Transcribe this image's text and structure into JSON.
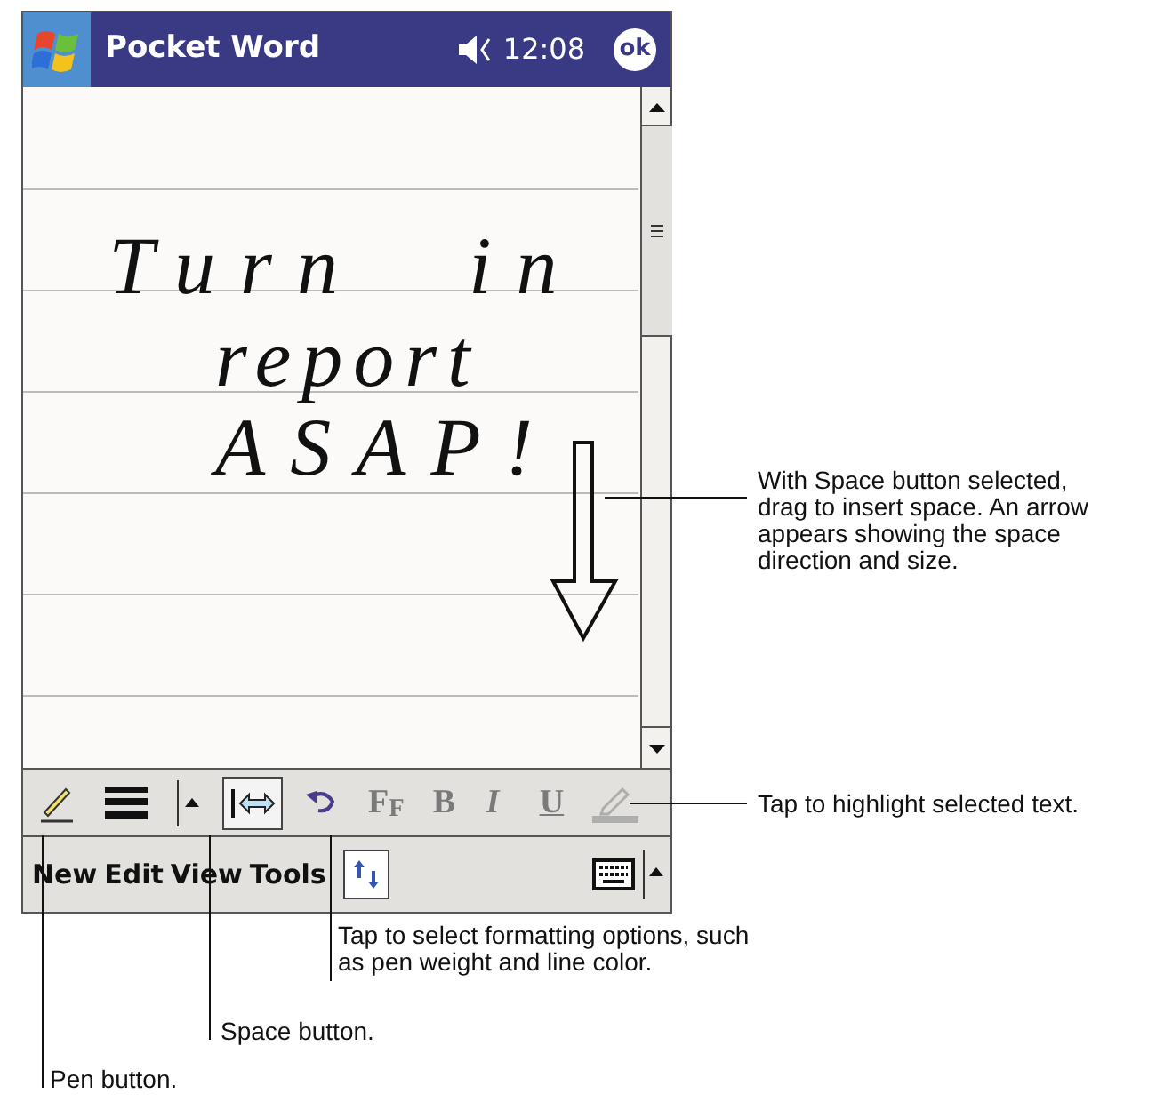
{
  "title_bar": {
    "title": "Pocket Word",
    "time": "12:08",
    "ok_button": "ok"
  },
  "document": {
    "ink_lines": [
      "Turn in",
      "report",
      "ASAP!"
    ]
  },
  "toolbar": [
    {
      "kind": "pen",
      "selected": false,
      "disabled": false
    },
    {
      "kind": "weight",
      "selected": false,
      "disabled": false
    },
    {
      "kind": "dropdown",
      "selected": false,
      "disabled": false
    },
    {
      "kind": "space",
      "selected": true,
      "disabled": false
    },
    {
      "kind": "undo",
      "selected": false,
      "disabled": false
    },
    {
      "kind": "font",
      "label": "F$_{F}$",
      "selected": false,
      "disabled": true
    },
    {
      "kind": "bold",
      "label": "B",
      "selected": false,
      "disabled": true
    },
    {
      "kind": "italic",
      "label": "I",
      "selected": false,
      "disabled": true
    },
    {
      "kind": "underline",
      "label": "U",
      "selected": false,
      "disabled": true
    },
    {
      "kind": "highlight",
      "selected": false,
      "disabled": true
    }
  ],
  "menu_bar": {
    "menus": [
      "New",
      "Edit",
      "View",
      "Tools"
    ]
  },
  "callouts": [
    {
      "text": "With Space button selected, drag to insert space. An arrow appears showing the space direction and size."
    },
    {
      "text": "Tap to highlight selected text."
    },
    {
      "text": "Tap to select formatting options, such as pen weight and line color."
    },
    {
      "text": "Space button."
    },
    {
      "text": "Pen button."
    }
  ]
}
